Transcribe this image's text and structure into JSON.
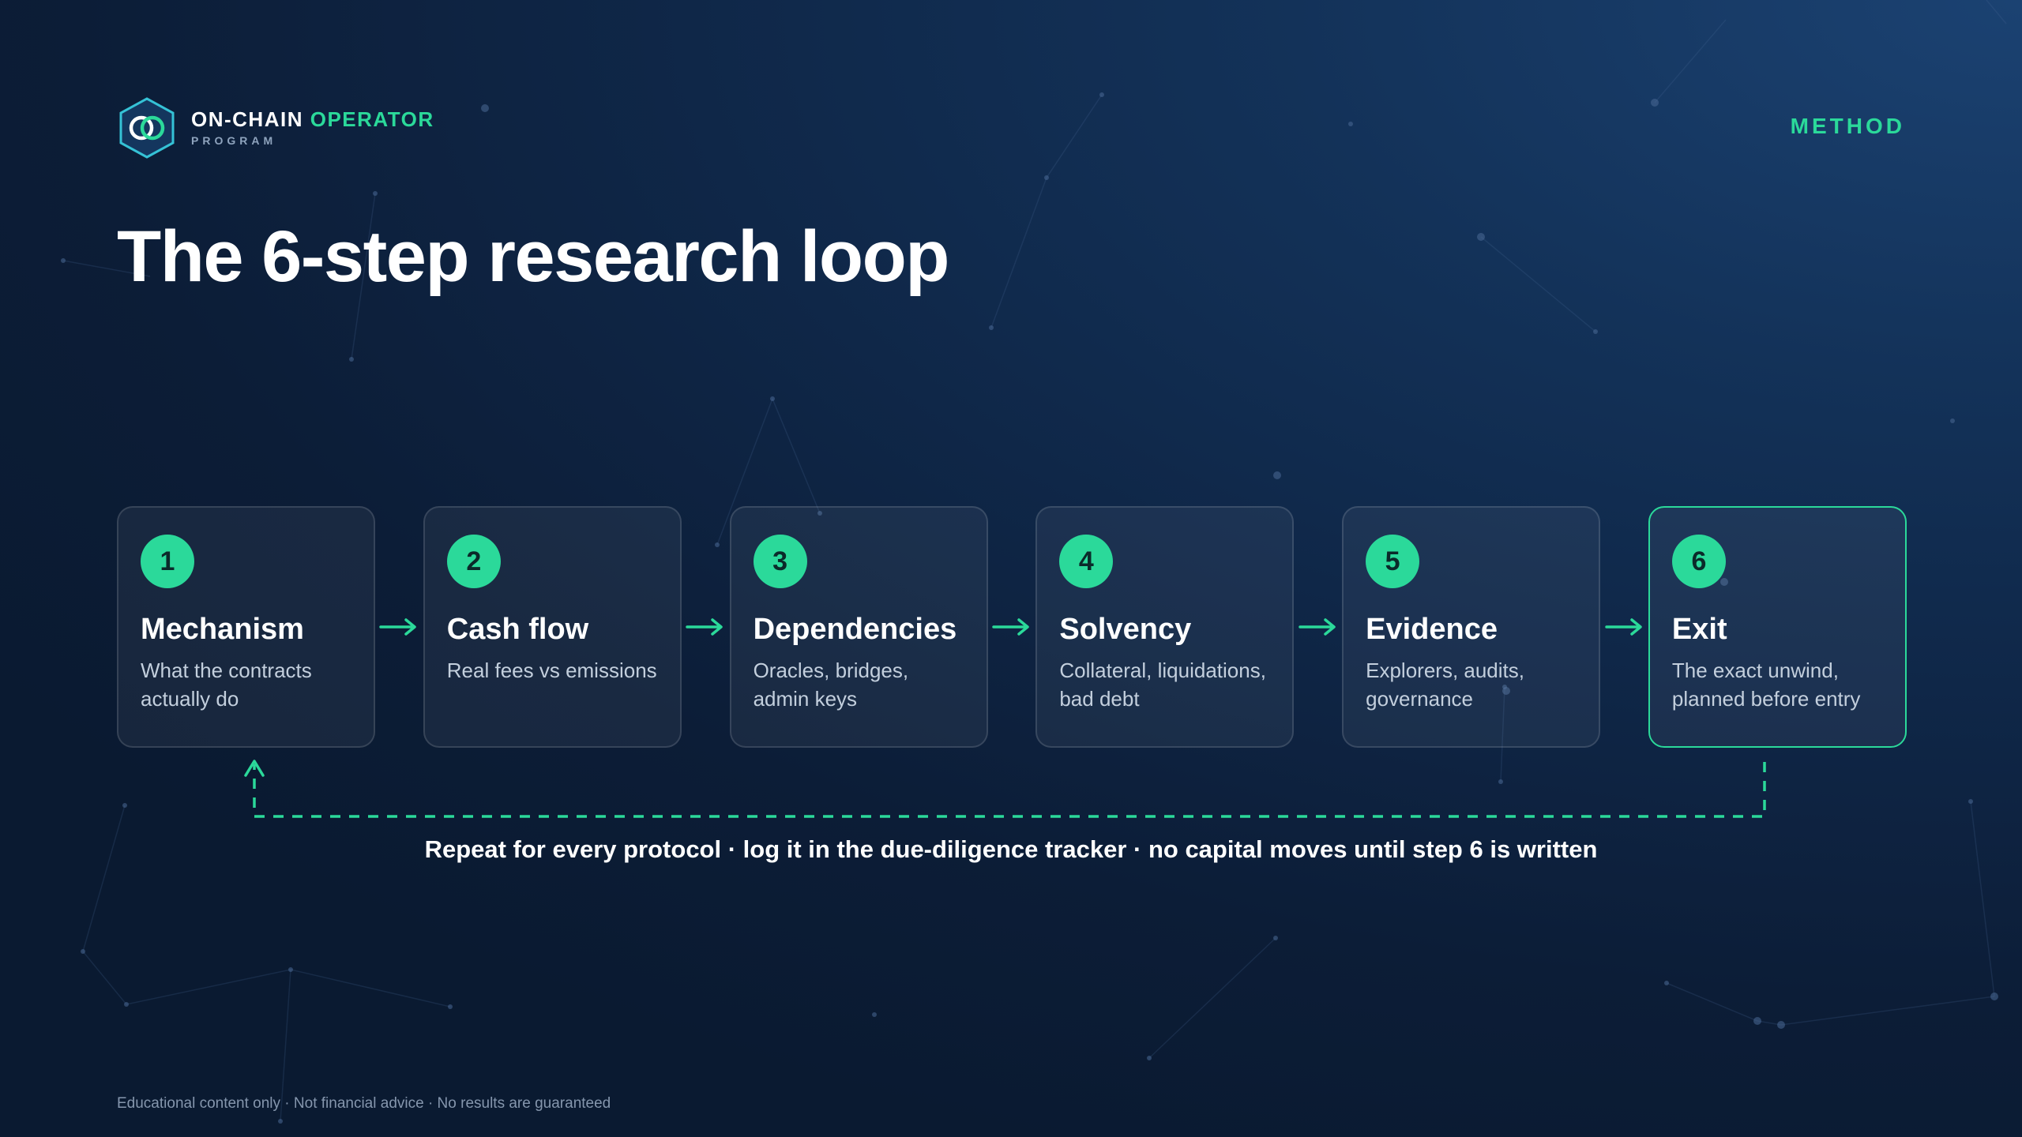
{
  "brand": {
    "title_part1": "ON-CHAIN",
    "title_part2": "OPERATOR",
    "subtitle": "PROGRAM",
    "logo_icon": "hexagon-linked-rings-icon"
  },
  "section_label": "METHOD",
  "page_title": "The 6-step research loop",
  "steps": [
    {
      "number": "1",
      "title": "Mechanism",
      "desc": "What the contracts actually do"
    },
    {
      "number": "2",
      "title": "Cash flow",
      "desc": "Real fees vs emissions"
    },
    {
      "number": "3",
      "title": "Dependencies",
      "desc": "Oracles, bridges, admin keys"
    },
    {
      "number": "4",
      "title": "Solvency",
      "desc": "Collateral, liquidations, bad debt"
    },
    {
      "number": "5",
      "title": "Evidence",
      "desc": "Explorers, audits, governance"
    },
    {
      "number": "6",
      "title": "Exit",
      "desc": "The exact unwind, planned before entry"
    }
  ],
  "loop_caption": "Repeat for every protocol · log it in the due-diligence tracker · no capital moves until step 6 is written",
  "footer": "Educational content only · Not financial advice · No results are guaranteed",
  "colors": {
    "accent": "#2bd99a",
    "background_top": "#1b4272",
    "background_bottom": "#0a1a31",
    "card_border_active": "#2bd99a"
  }
}
